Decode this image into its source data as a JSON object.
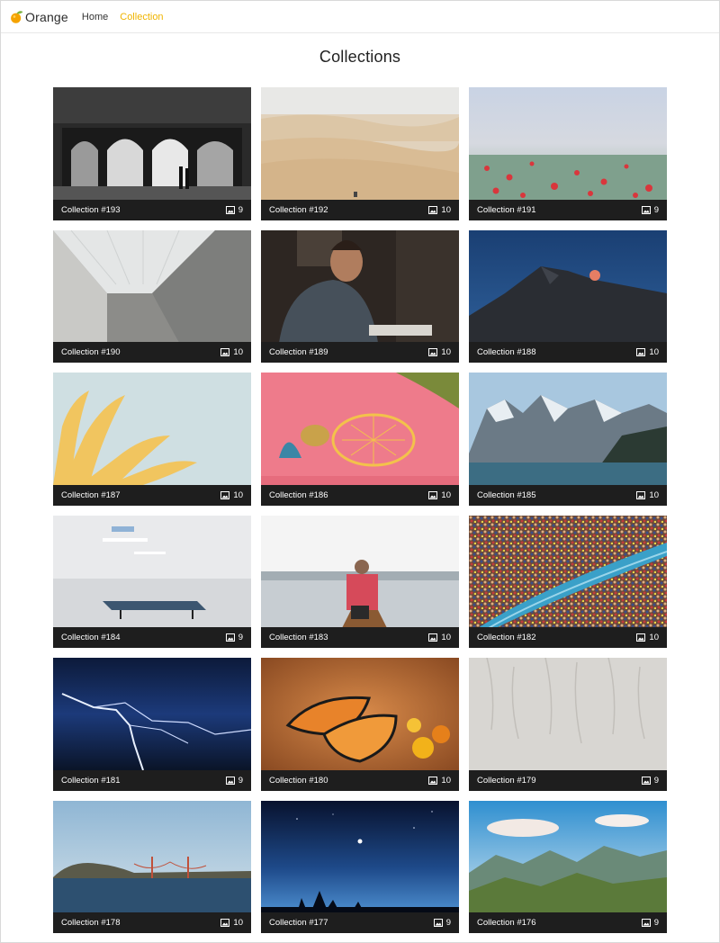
{
  "brand": {
    "name": "Orange"
  },
  "nav": {
    "home_label": "Home",
    "collection_label": "Collection"
  },
  "page": {
    "title": "Collections"
  },
  "colors": {
    "accent": "#f0b400",
    "card_bar": "#1e1e1e"
  },
  "collections": [
    {
      "label": "Collection #193",
      "count": "9"
    },
    {
      "label": "Collection #192",
      "count": "10"
    },
    {
      "label": "Collection #191",
      "count": "9"
    },
    {
      "label": "Collection #190",
      "count": "10"
    },
    {
      "label": "Collection #189",
      "count": "10"
    },
    {
      "label": "Collection #188",
      "count": "10"
    },
    {
      "label": "Collection #187",
      "count": "10"
    },
    {
      "label": "Collection #186",
      "count": "10"
    },
    {
      "label": "Collection #185",
      "count": "10"
    },
    {
      "label": "Collection #184",
      "count": "9"
    },
    {
      "label": "Collection #183",
      "count": "10"
    },
    {
      "label": "Collection #182",
      "count": "10"
    },
    {
      "label": "Collection #181",
      "count": "9"
    },
    {
      "label": "Collection #180",
      "count": "10"
    },
    {
      "label": "Collection #179",
      "count": "9"
    },
    {
      "label": "Collection #178",
      "count": "10"
    },
    {
      "label": "Collection #177",
      "count": "9"
    },
    {
      "label": "Collection #176",
      "count": "9"
    }
  ]
}
